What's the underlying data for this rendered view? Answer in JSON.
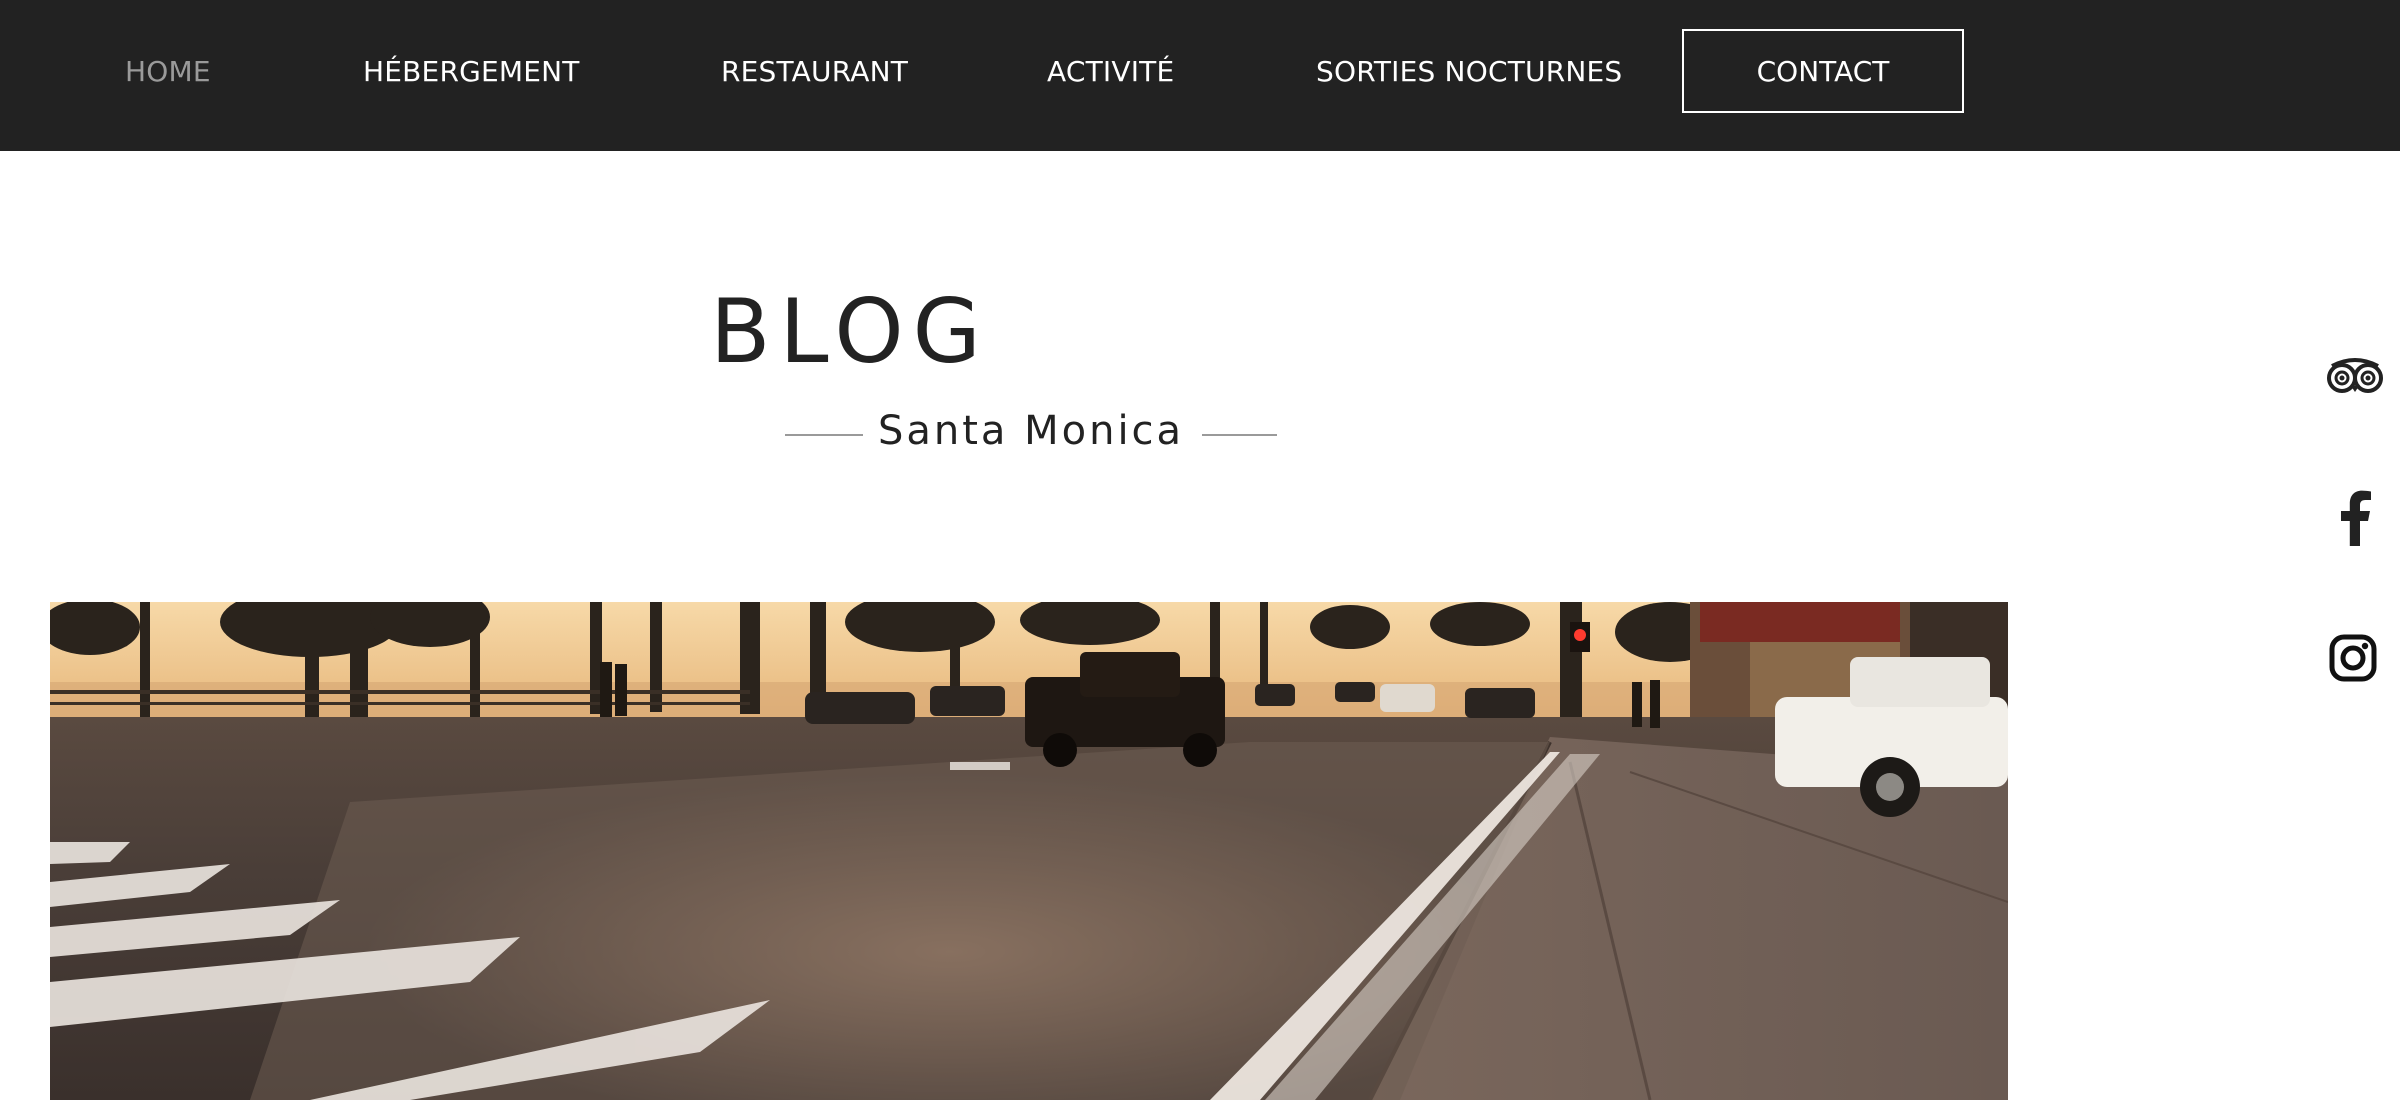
{
  "nav": {
    "items": [
      {
        "label": "HOME",
        "active": true
      },
      {
        "label": "HÉBERGEMENT",
        "active": false
      },
      {
        "label": "RESTAURANT",
        "active": false
      },
      {
        "label": "ACTIVITÉ",
        "active": false
      },
      {
        "label": "SORTIES NOCTURNES",
        "active": false
      }
    ],
    "contact_label": "CONTACT"
  },
  "header": {
    "title": "BLOG",
    "subtitle": "Santa Monica"
  },
  "hero": {
    "icon": "street-photo"
  },
  "social": [
    {
      "icon": "tripadvisor-icon"
    },
    {
      "icon": "facebook-icon"
    },
    {
      "icon": "instagram-icon"
    }
  ],
  "colors": {
    "nav_bg": "#222222",
    "nav_text": "#ffffff",
    "nav_active": "#9a9a9a",
    "text_dark": "#222222"
  }
}
